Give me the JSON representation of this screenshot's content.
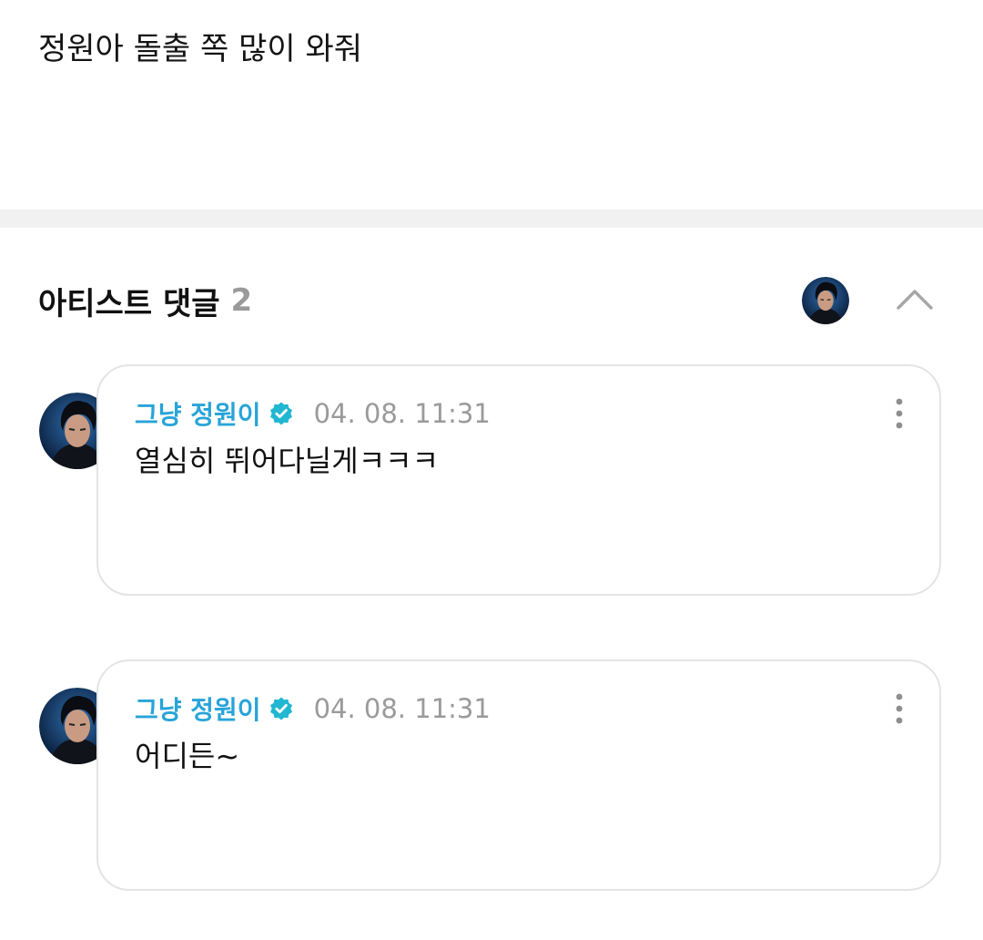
{
  "post": {
    "text": "정원아 돌출 쪽 많이 와줘"
  },
  "artist_comments": {
    "title": "아티스트 댓글",
    "count": "2",
    "header_avatar_icon": "artist-avatar-icon",
    "collapse_icon": "chevron-up-icon"
  },
  "comments": [
    {
      "author": "그냥 정원이",
      "verified_icon": "verified-badge-icon",
      "time": "04. 08. 11:31",
      "text": "열심히 뛰어다닐게ㅋㅋㅋ",
      "more_icon": "more-vertical-icon"
    },
    {
      "author": "그냥 정원이",
      "verified_icon": "verified-badge-icon",
      "time": "04. 08. 11:31",
      "text": "어디든~",
      "more_icon": "more-vertical-icon"
    }
  ],
  "colors": {
    "author": "#28a4d8",
    "badge": "#21b7d2",
    "muted": "#9a9a9a",
    "divider": "#f1f1f2",
    "card_border": "#e4e4e6"
  }
}
